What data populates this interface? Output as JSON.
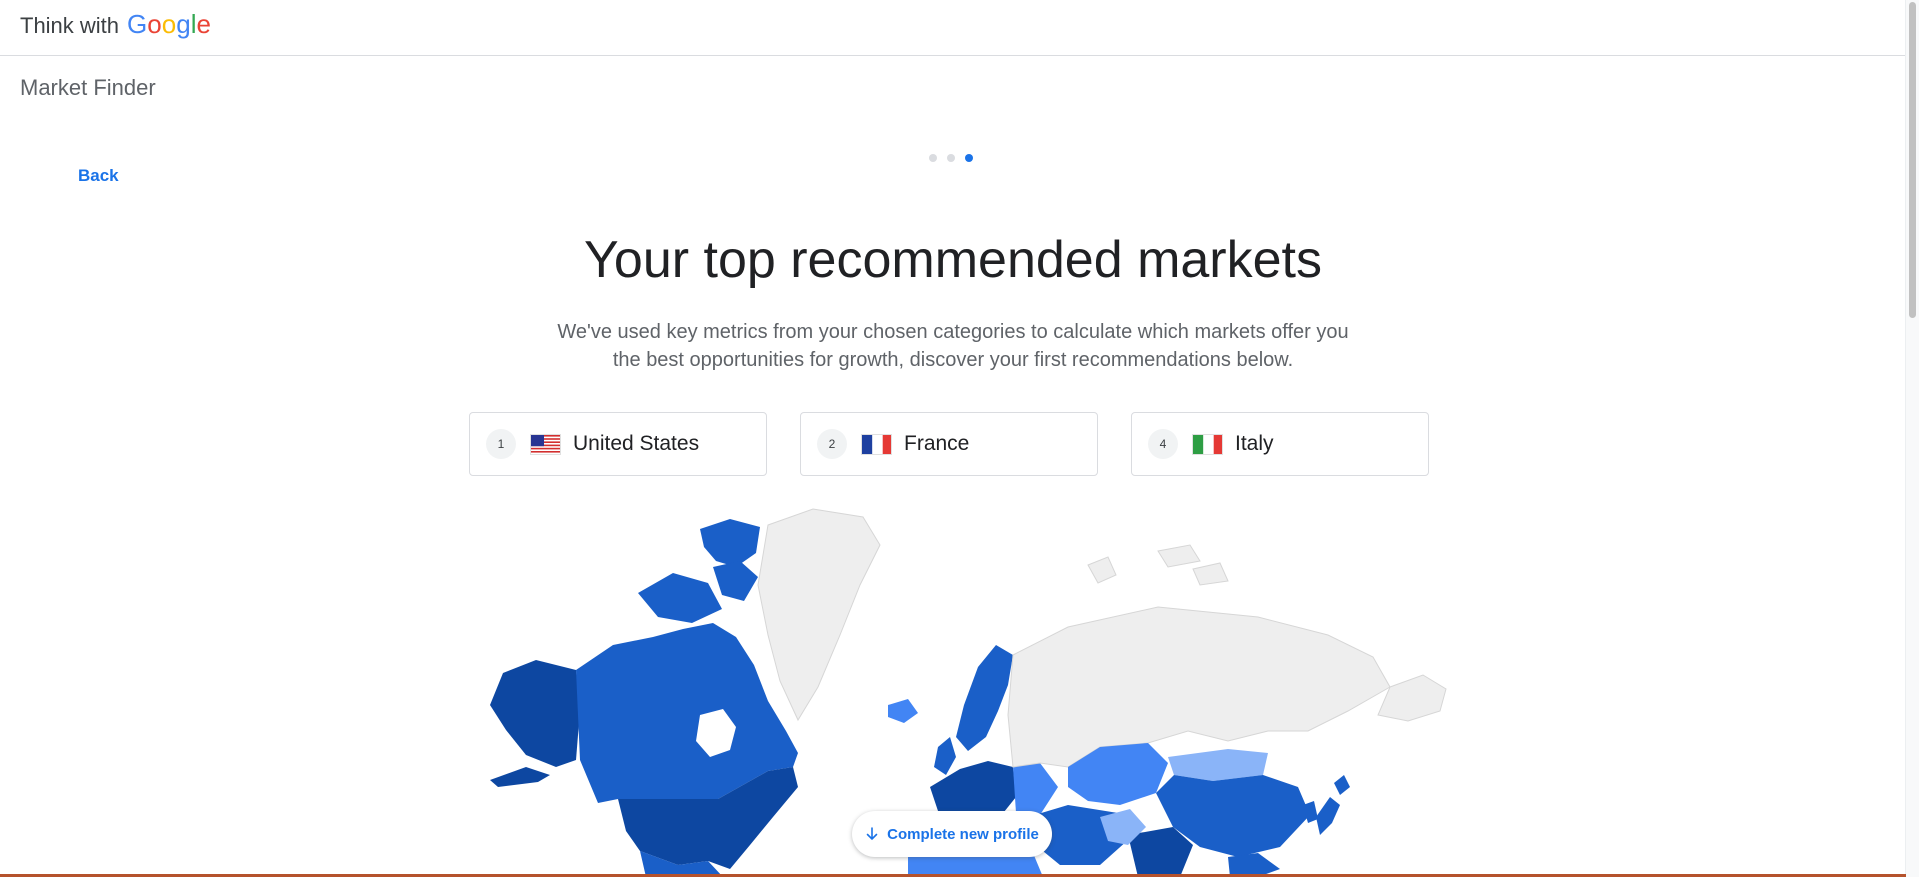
{
  "header": {
    "brand_prefix": "Think with",
    "brand_letters": [
      {
        "ch": "G",
        "color": "#4285F4"
      },
      {
        "ch": "o",
        "color": "#EA4335"
      },
      {
        "ch": "o",
        "color": "#FBBC05"
      },
      {
        "ch": "g",
        "color": "#4285F4"
      },
      {
        "ch": "l",
        "color": "#34A853"
      },
      {
        "ch": "e",
        "color": "#EA4335"
      }
    ]
  },
  "product_name": "Market Finder",
  "nav": {
    "back_label": "Back"
  },
  "stepper": {
    "total_steps": 3,
    "current_step": 3
  },
  "main": {
    "title": "Your top recommended markets",
    "subtitle_line1": "We've used key metrics from your chosen categories to calculate which markets offer you",
    "subtitle_line2": "the best opportunities for growth, discover your first recommendations below."
  },
  "markets": [
    {
      "rank": "1",
      "name": "United States",
      "flag": "us-flag-icon"
    },
    {
      "rank": "2",
      "name": "France",
      "flag": "fr-flag-icon"
    },
    {
      "rank": "4",
      "name": "Italy",
      "flag": "it-flag-icon"
    }
  ],
  "cta": {
    "label": "Complete new profile",
    "icon": "arrow-down-icon"
  },
  "colors": {
    "accent": "#1a73e8",
    "map_dark": "#0d47a1",
    "map_mid": "#1a5fc8",
    "map_light": "#4285f4",
    "map_pale": "#8ab4f8",
    "map_grey": "#eeeeee"
  }
}
